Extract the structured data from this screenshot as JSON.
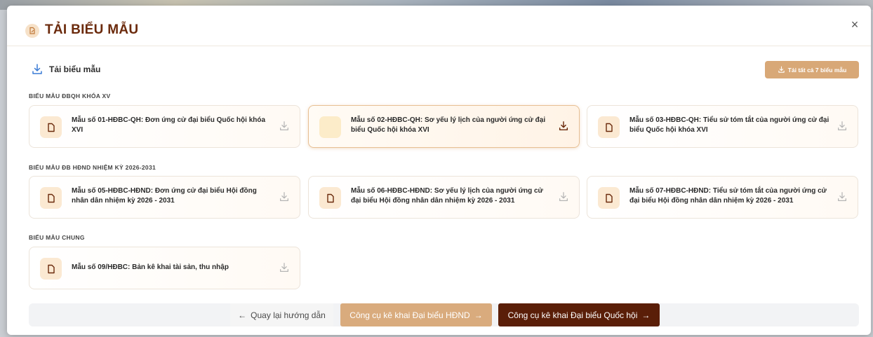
{
  "modal": {
    "title": "TẢI BIỂU MẪU",
    "close_label": "×"
  },
  "section": {
    "heading": "Tải biểu mẫu",
    "download_all_label": "Tải tất cả 7 biểu mẫu"
  },
  "groups": [
    {
      "label": "BIỂU MẪU ĐBQH KHÓA XV",
      "cards": [
        {
          "title": "Mẫu số 01-HĐBC-QH: Đơn ứng cử đại biểu Quốc hội khóa XVI",
          "active": false
        },
        {
          "title": "Mẫu số 02-HĐBC-QH: Sơ yếu lý lịch của người ứng cử đại biểu Quốc hội khóa XVI",
          "active": true
        },
        {
          "title": "Mẫu số 03-HĐBC-QH: Tiểu sử tóm tắt của người ứng cử đại biểu Quốc hội khóa XVI",
          "active": false
        }
      ]
    },
    {
      "label": "BIỂU MẪU ĐB HĐND NHIỆM KỲ 2026-2031",
      "cards": [
        {
          "title": "Mẫu số 05-HĐBC-HĐND: Đơn ứng cử đại biểu Hội đồng nhân dân nhiệm kỳ 2026 - 2031",
          "active": false
        },
        {
          "title": "Mẫu số 06-HĐBC-HĐND: Sơ yếu lý lịch của người ứng cử đại biểu Hội đồng nhân dân nhiệm kỳ 2026 - 2031",
          "active": false
        },
        {
          "title": "Mẫu số 07-HĐBC-HĐND: Tiểu sử tóm tắt của người ứng cử đại biểu Hội đồng nhân dân nhiệm kỳ 2026 - 2031",
          "active": false
        }
      ]
    },
    {
      "label": "BIỂU MẪU CHUNG",
      "cards": [
        {
          "title": "Mẫu số 09/HĐBC: Bản kê khai tài sản, thu nhập",
          "active": false
        }
      ]
    }
  ],
  "footer": {
    "back_label": "Quay lại hướng dẫn",
    "hdnd_tool_label": "Công cụ kê khai Đại biểu HĐND",
    "qh_tool_label": "Công cụ kê khai Đại biểu Quốc hội"
  },
  "colors": {
    "brand_dark": "#5a1e08",
    "brand_light": "#d9ab7d",
    "title": "#6b2a0c"
  },
  "icons": {
    "title": "edit-document-icon",
    "card": "document-icon",
    "download": "download-icon",
    "close": "close-icon",
    "back": "arrow-left-icon",
    "forward": "arrow-right-icon"
  }
}
